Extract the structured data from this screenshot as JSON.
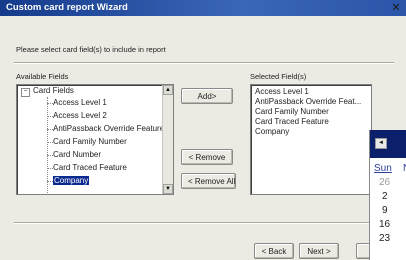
{
  "window": {
    "title": "Custom card report Wizard",
    "close_glyph": "✕"
  },
  "instruction": "Please select card field(s) to include in report",
  "available": {
    "label": "Available Fields",
    "root": {
      "expander": "−",
      "label": "Card Fields"
    },
    "items": [
      "Access Level 1",
      "Access Level 2",
      "AntiPassback Override Feature",
      "Card Family Number",
      "Card Number",
      "Card Traced Feature",
      "Company"
    ],
    "selected_index": 6
  },
  "selected": {
    "label": "Selected Field(s)",
    "items": [
      "Access Level 1",
      "AntiPassback Override Feat...",
      "Card Family Number",
      "Card Traced Feature",
      "Company"
    ]
  },
  "buttons": {
    "add": "Add>",
    "remove": "< Remove",
    "remove_all": "< Remove All",
    "back": "< Back",
    "next": "Next >"
  },
  "calendar": {
    "prev_glyph": "◄",
    "day_name": "Sun",
    "next_day_partial": "N",
    "dates": [
      {
        "text": "26",
        "muted": true
      },
      {
        "text": "2",
        "muted": false
      },
      {
        "text": "9",
        "muted": false
      },
      {
        "text": "16",
        "muted": false
      },
      {
        "text": "23",
        "muted": false
      }
    ]
  },
  "colors": {
    "titlebar": "#153a8c",
    "selection": "#0b2a8f",
    "calendar_header": "#0b1f6b"
  }
}
